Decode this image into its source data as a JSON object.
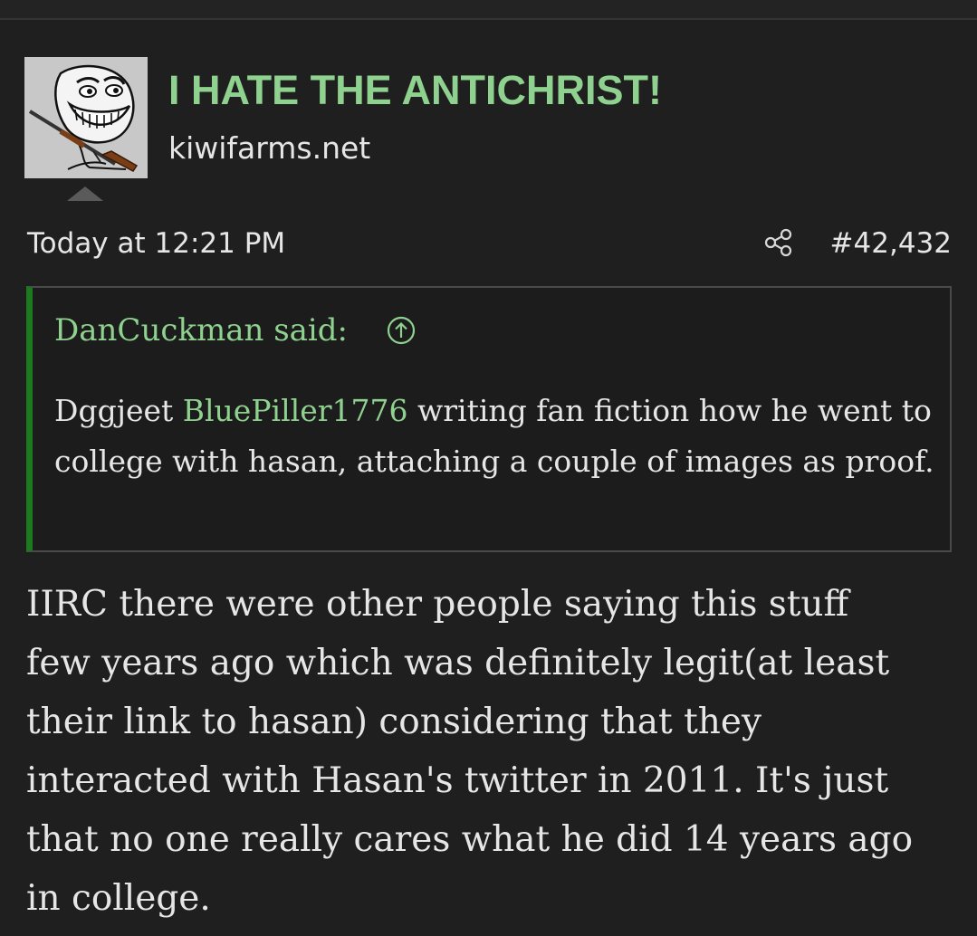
{
  "post": {
    "username": "I HATE THE ANTICHRIST!",
    "user_title": "kiwifarms.net",
    "timestamp": "Today at 12:21 PM",
    "post_number": "#42,432",
    "avatar_icon": "trollface-with-rifle",
    "share_icon": "share-icon"
  },
  "quote": {
    "author": "DanCuckman said:",
    "body_before_mention": "Dggjeet ",
    "mention": "BluePiller1776",
    "body_after_mention": " writing fan fiction how he went to college with hasan, attaching a couple of images as proof."
  },
  "message": {
    "lines": [
      "IIRC there were other people saying this stuff",
      "few years ago which was definitely legit(at least",
      "their link to hasan) considering that they",
      "interacted with Hasan's twitter in 2011. It's just",
      "that no one really cares what he did 14 years ago",
      "in college."
    ]
  },
  "colors": {
    "background": "#1d1d1d",
    "username": "#8fd18f",
    "quote_accent": "#1c7a1c",
    "text": "#e6e6e6"
  }
}
